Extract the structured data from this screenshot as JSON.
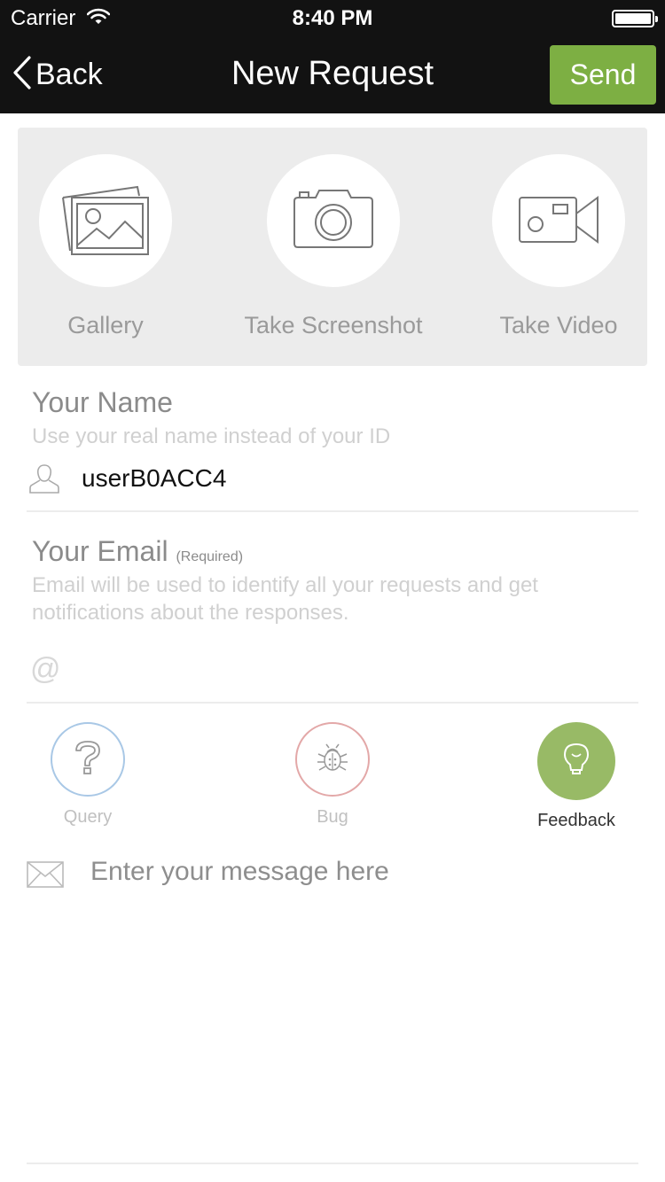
{
  "status_bar": {
    "carrier": "Carrier",
    "time": "8:40 PM",
    "icons": [
      "wifi-icon",
      "battery-icon"
    ]
  },
  "nav": {
    "back_label": "Back",
    "title": "New Request",
    "send_label": "Send"
  },
  "attachments": {
    "items": [
      {
        "label": "Gallery",
        "icon": "gallery-icon"
      },
      {
        "label": "Take Screenshot",
        "icon": "camera-icon"
      },
      {
        "label": "Take Video",
        "icon": "video-camera-icon"
      }
    ]
  },
  "name_field": {
    "title": "Your Name",
    "help": "Use your real name instead of your ID",
    "value": "userB0ACC4",
    "icon": "person-icon"
  },
  "email_field": {
    "title": "Your Email",
    "required_label": "(Required)",
    "help": "Email will be used to identify all your requests and get notifications about the responses.",
    "at_symbol": "@",
    "value": ""
  },
  "request_types": {
    "items": [
      {
        "label": "Query",
        "icon": "question-icon",
        "color": "#a9c8e6",
        "selected": false
      },
      {
        "label": "Bug",
        "icon": "bug-icon",
        "color": "#e3a8a8",
        "selected": false
      },
      {
        "label": "Feedback",
        "icon": "lightbulb-icon",
        "color": "#98ba66",
        "selected": true
      }
    ]
  },
  "message": {
    "placeholder": "Enter your message here",
    "icon": "envelope-icon"
  },
  "colors": {
    "nav_background": "#121212",
    "accent_green": "#7daf43",
    "panel_gray": "#ececec"
  }
}
